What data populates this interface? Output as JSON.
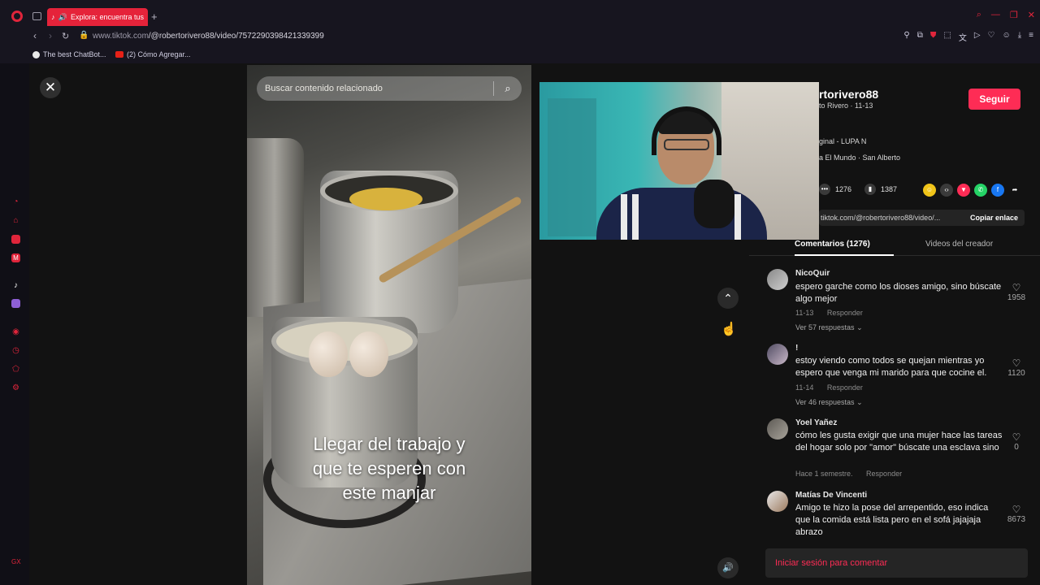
{
  "browser": {
    "tab_title": "Explora: encuentra tus",
    "url_prefix": "www.tiktok.com",
    "url_path": "/@robertorivero88/video/7572290398421339399",
    "bookmarks": [
      {
        "label": "The best ChatBot..."
      },
      {
        "label": "(2) Cómo Agregar..."
      }
    ],
    "new_tab_symbol": "+",
    "accent": "#e0253b"
  },
  "video": {
    "search_placeholder": "Buscar contenido relacionado",
    "caption_lines": [
      "Llegar del trabajo y",
      "que te esperen con",
      "este manjar"
    ]
  },
  "author": {
    "handle": "rtorivero88",
    "sub": "to Rivero · 11-13",
    "follow_label": "Seguir",
    "music": "ginal - LUPA N",
    "location": "a El Mundo · San Alberto"
  },
  "stats": {
    "comments": "1276",
    "saves": "1387"
  },
  "link": {
    "text": "tiktok.com/@robertorivero88/video/...",
    "copy_label": "Copiar enlace"
  },
  "tabs": {
    "comments_label": "Comentarios (1276)",
    "creator_label": "Videos del creador"
  },
  "comments": [
    {
      "user": "NicoQuir",
      "text": "espero garche como los dioses amigo, sino búscate algo mejor",
      "date": "11-13",
      "reply": "Responder",
      "replies": "Ver 57 respuestas",
      "likes": "1958"
    },
    {
      "user": "!",
      "text": "estoy viendo como todos se quejan mientras yo espero que venga mi marido para que cocine el.",
      "date": "11-14",
      "reply": "Responder",
      "replies": "Ver 46 respuestas",
      "likes": "1120"
    },
    {
      "user": "Yoel Yañez",
      "text": "cómo les gusta exigir que una mujer hace las tareas del hogar solo por \"amor\" búscate una esclava sino",
      "date": "Hace 1 semestre.",
      "reply": "Responder",
      "replies": "",
      "likes": "0"
    },
    {
      "user": "Matías De Vincenti",
      "text": "Amigo te hizo la pose del arrepentido, eso indica que la comida está lista pero en el sofá jajajaja abrazo ",
      "date": "",
      "reply": "",
      "replies": "",
      "likes": "8673"
    }
  ],
  "login_label": "Iniciar sesión para comentar",
  "colors": {
    "tiktok_red": "#fe2c55",
    "background": "#121212"
  }
}
